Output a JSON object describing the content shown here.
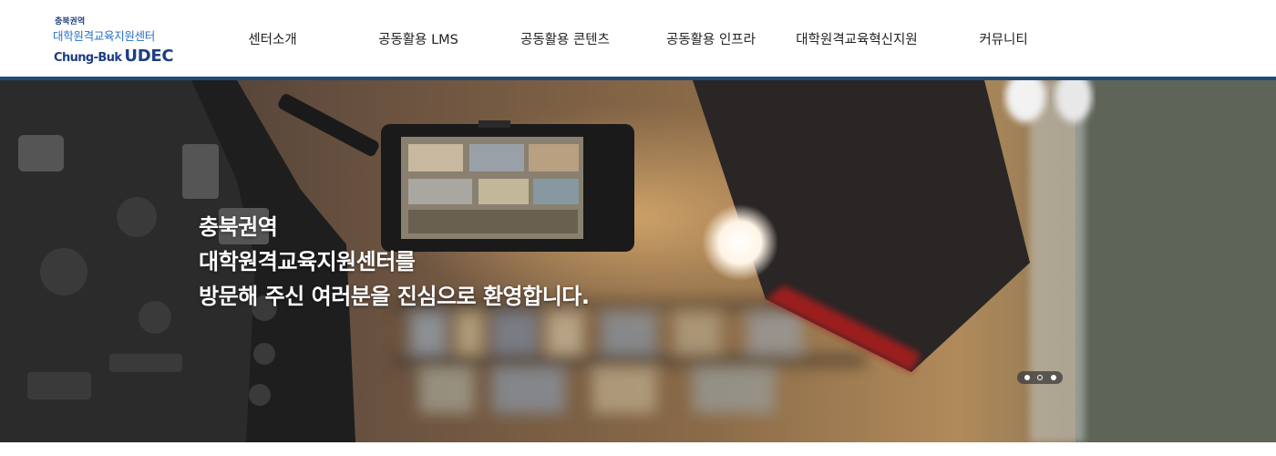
{
  "logo": {
    "top_text": "충북권역",
    "mid_text": "대학원격교육지원센터",
    "bottom_text_a": "Chung-Buk",
    "bottom_text_b": "UDEC"
  },
  "nav": {
    "items": [
      {
        "label": "센터소개"
      },
      {
        "label": "공동활용 LMS"
      },
      {
        "label": "공동활용 콘텐츠"
      },
      {
        "label": "공동활용 인프라"
      },
      {
        "label": "대학원격교육혁신지원"
      },
      {
        "label": "커뮤니티"
      }
    ]
  },
  "hero": {
    "line1": "충북권역",
    "line2": "대학원격교육지원센터를",
    "line3": "방문해 주신 여러분을 진심으로 환영합니다."
  },
  "slider": {
    "slide_count": 3,
    "active_index": 1
  },
  "colors": {
    "brand_dark": "#1d3f82",
    "brand_light": "#2a6fc8",
    "header_line": "#1f4a7a"
  }
}
